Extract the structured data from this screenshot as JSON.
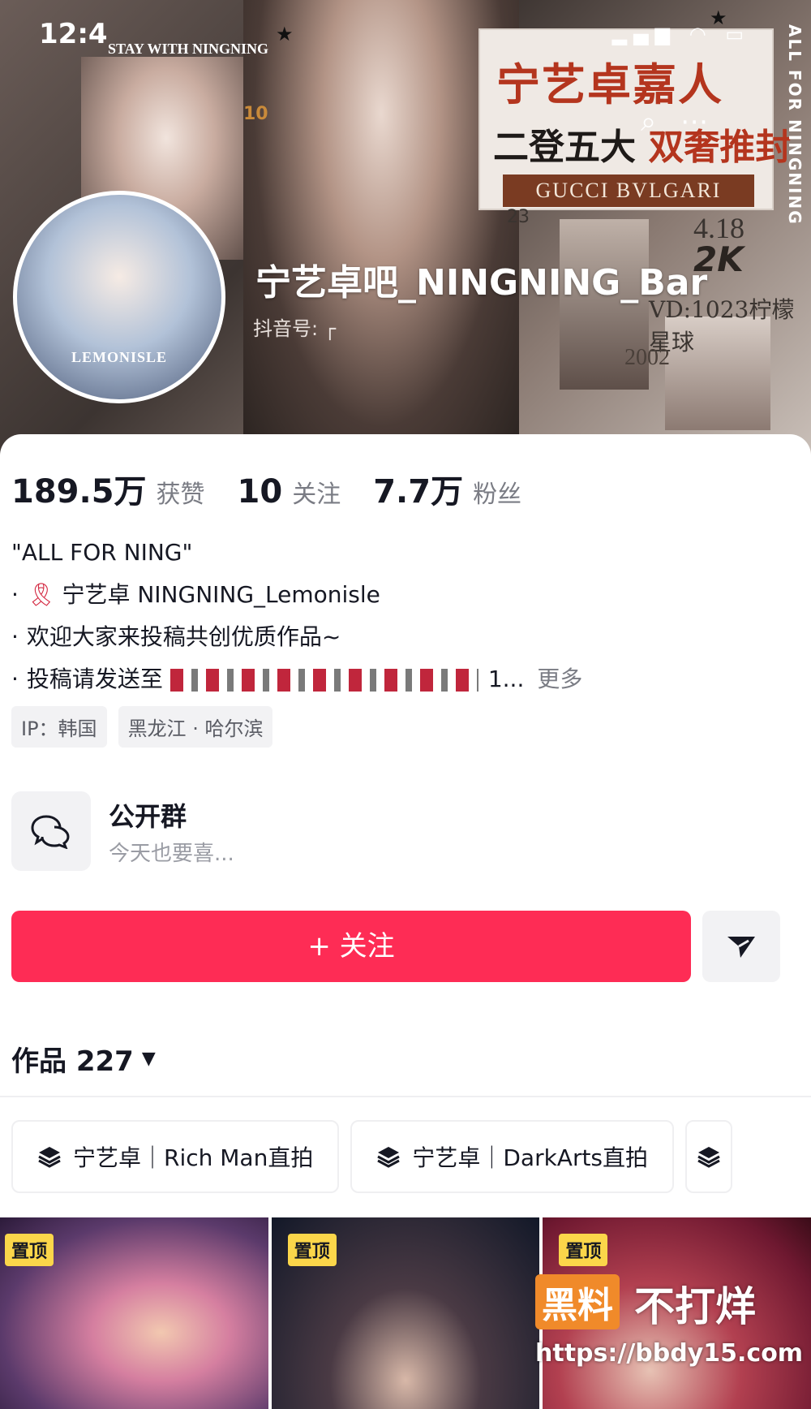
{
  "status_bar": {
    "time": "12:4",
    "icons": "▂▄▆ ◠ ▭"
  },
  "banner": {
    "stay_text": "STAY WITH NINGNING",
    "num_10": "10",
    "poster_title": "宁艺卓嘉人",
    "poster_sub_a": "二登五大",
    "poster_sub_b": "双奢推封",
    "poster_brand": "GUCCI BVLGARI",
    "num_23": "23",
    "date": "4.18",
    "text_2k": "2K",
    "vd": "VD:1023柠檬星球",
    "year": "2002",
    "vertical": "ALL FOR NINGNING",
    "avatar_label": "LEMONISLE"
  },
  "profile": {
    "nickname": "宁艺卓吧_NINGNING_Bar",
    "douyin_id": "抖音号: ┌"
  },
  "stats": [
    {
      "num": "189.5万",
      "label": "获赞"
    },
    {
      "num": "10",
      "label": "关注"
    },
    {
      "num": "7.7万",
      "label": "粉丝"
    }
  ],
  "bio": {
    "line1": "\"ALL FOR NING\"",
    "line2": "宁艺卓 NINGNING_Lemonisle",
    "line3": "欢迎大家来投稿共创优质作品~",
    "line4_prefix": "投稿请发送至",
    "line4_suffix": "1...",
    "more": "更多",
    "dot": "·"
  },
  "tags": [
    "IP：韩国",
    "黑龙江 · 哈尔滨"
  ],
  "group": {
    "name": "公开群",
    "desc": "今天也要喜..."
  },
  "follow_label": "+ 关注",
  "works": {
    "label": "作品 227",
    "caret": "▼"
  },
  "collections": [
    "宁艺卓｜Rich Man直拍",
    "宁艺卓｜DarkArts直拍"
  ],
  "pin_label": "置顶",
  "watermark": {
    "box": "黑料",
    "text": "不打烊",
    "url": "https://bbdy15.com"
  },
  "colors": {
    "accent": "#fe2c55",
    "pin": "#fbd64a",
    "watermark": "#f08a2a"
  }
}
